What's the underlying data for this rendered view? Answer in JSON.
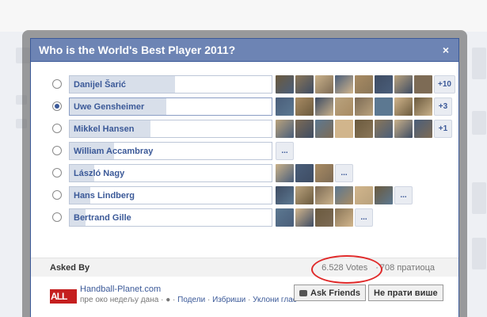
{
  "dialog": {
    "title": "Who is the World's Best Player 2011?",
    "close_icon": "×"
  },
  "options": [
    {
      "label": "Danijel Šarić",
      "share": 0.52,
      "selected": false,
      "faces": 8,
      "more": "+10"
    },
    {
      "label": "Uwe Gensheimer",
      "share": 0.48,
      "selected": true,
      "faces": 8,
      "more": "+3"
    },
    {
      "label": "Mikkel Hansen",
      "share": 0.4,
      "selected": false,
      "faces": 8,
      "more": "+1"
    },
    {
      "label": "William Accambray",
      "share": 0.22,
      "selected": false,
      "faces": 0,
      "more": "..."
    },
    {
      "label": "László Nagy",
      "share": 0.12,
      "selected": false,
      "faces": 3,
      "more": "..."
    },
    {
      "label": "Hans Lindberg",
      "share": 0.1,
      "selected": false,
      "faces": 6,
      "more": "..."
    },
    {
      "label": "Bertrand Gille",
      "share": 0.08,
      "selected": false,
      "faces": 4,
      "more": "..."
    }
  ],
  "asked": {
    "label": "Asked By",
    "votes": "6.528 Votes",
    "separator": "·",
    "followers": "708 пратиоца"
  },
  "creator": {
    "logo_text": "ALL",
    "name": "Handball-Planet.com",
    "time": "пре око недељу дана",
    "separator": "·",
    "share_link": "Подели",
    "delete_link": "Избриши",
    "remove_link": "Уклони глас"
  },
  "buttons": {
    "ask_friends": "Ask Friends",
    "unfollow": "Не прати више"
  },
  "colors": {
    "header": "#6d84b4",
    "border": "#3b5998",
    "link": "#3b5998",
    "bar_fill": "#d8dfea",
    "highlight_circle": "#e02a2a"
  }
}
